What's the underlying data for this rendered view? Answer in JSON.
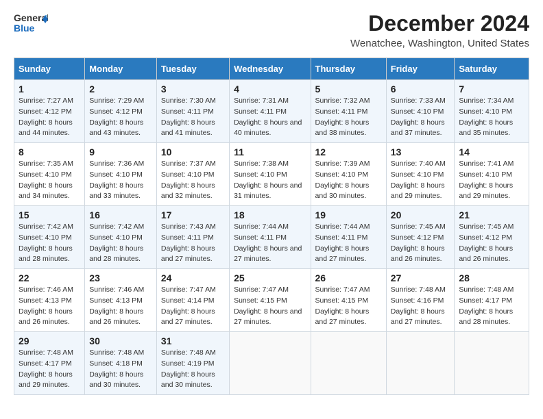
{
  "logo": {
    "line1": "General",
    "line2": "Blue"
  },
  "title": "December 2024",
  "location": "Wenatchee, Washington, United States",
  "days_header": [
    "Sunday",
    "Monday",
    "Tuesday",
    "Wednesday",
    "Thursday",
    "Friday",
    "Saturday"
  ],
  "weeks": [
    [
      {
        "day": "1",
        "sunrise": "7:27 AM",
        "sunset": "4:12 PM",
        "daylight": "8 hours and 44 minutes."
      },
      {
        "day": "2",
        "sunrise": "7:29 AM",
        "sunset": "4:12 PM",
        "daylight": "8 hours and 43 minutes."
      },
      {
        "day": "3",
        "sunrise": "7:30 AM",
        "sunset": "4:11 PM",
        "daylight": "8 hours and 41 minutes."
      },
      {
        "day": "4",
        "sunrise": "7:31 AM",
        "sunset": "4:11 PM",
        "daylight": "8 hours and 40 minutes."
      },
      {
        "day": "5",
        "sunrise": "7:32 AM",
        "sunset": "4:11 PM",
        "daylight": "8 hours and 38 minutes."
      },
      {
        "day": "6",
        "sunrise": "7:33 AM",
        "sunset": "4:10 PM",
        "daylight": "8 hours and 37 minutes."
      },
      {
        "day": "7",
        "sunrise": "7:34 AM",
        "sunset": "4:10 PM",
        "daylight": "8 hours and 35 minutes."
      }
    ],
    [
      {
        "day": "8",
        "sunrise": "7:35 AM",
        "sunset": "4:10 PM",
        "daylight": "8 hours and 34 minutes."
      },
      {
        "day": "9",
        "sunrise": "7:36 AM",
        "sunset": "4:10 PM",
        "daylight": "8 hours and 33 minutes."
      },
      {
        "day": "10",
        "sunrise": "7:37 AM",
        "sunset": "4:10 PM",
        "daylight": "8 hours and 32 minutes."
      },
      {
        "day": "11",
        "sunrise": "7:38 AM",
        "sunset": "4:10 PM",
        "daylight": "8 hours and 31 minutes."
      },
      {
        "day": "12",
        "sunrise": "7:39 AM",
        "sunset": "4:10 PM",
        "daylight": "8 hours and 30 minutes."
      },
      {
        "day": "13",
        "sunrise": "7:40 AM",
        "sunset": "4:10 PM",
        "daylight": "8 hours and 29 minutes."
      },
      {
        "day": "14",
        "sunrise": "7:41 AM",
        "sunset": "4:10 PM",
        "daylight": "8 hours and 29 minutes."
      }
    ],
    [
      {
        "day": "15",
        "sunrise": "7:42 AM",
        "sunset": "4:10 PM",
        "daylight": "8 hours and 28 minutes."
      },
      {
        "day": "16",
        "sunrise": "7:42 AM",
        "sunset": "4:10 PM",
        "daylight": "8 hours and 28 minutes."
      },
      {
        "day": "17",
        "sunrise": "7:43 AM",
        "sunset": "4:11 PM",
        "daylight": "8 hours and 27 minutes."
      },
      {
        "day": "18",
        "sunrise": "7:44 AM",
        "sunset": "4:11 PM",
        "daylight": "8 hours and 27 minutes."
      },
      {
        "day": "19",
        "sunrise": "7:44 AM",
        "sunset": "4:11 PM",
        "daylight": "8 hours and 27 minutes."
      },
      {
        "day": "20",
        "sunrise": "7:45 AM",
        "sunset": "4:12 PM",
        "daylight": "8 hours and 26 minutes."
      },
      {
        "day": "21",
        "sunrise": "7:45 AM",
        "sunset": "4:12 PM",
        "daylight": "8 hours and 26 minutes."
      }
    ],
    [
      {
        "day": "22",
        "sunrise": "7:46 AM",
        "sunset": "4:13 PM",
        "daylight": "8 hours and 26 minutes."
      },
      {
        "day": "23",
        "sunrise": "7:46 AM",
        "sunset": "4:13 PM",
        "daylight": "8 hours and 26 minutes."
      },
      {
        "day": "24",
        "sunrise": "7:47 AM",
        "sunset": "4:14 PM",
        "daylight": "8 hours and 27 minutes."
      },
      {
        "day": "25",
        "sunrise": "7:47 AM",
        "sunset": "4:15 PM",
        "daylight": "8 hours and 27 minutes."
      },
      {
        "day": "26",
        "sunrise": "7:47 AM",
        "sunset": "4:15 PM",
        "daylight": "8 hours and 27 minutes."
      },
      {
        "day": "27",
        "sunrise": "7:48 AM",
        "sunset": "4:16 PM",
        "daylight": "8 hours and 27 minutes."
      },
      {
        "day": "28",
        "sunrise": "7:48 AM",
        "sunset": "4:17 PM",
        "daylight": "8 hours and 28 minutes."
      }
    ],
    [
      {
        "day": "29",
        "sunrise": "7:48 AM",
        "sunset": "4:17 PM",
        "daylight": "8 hours and 29 minutes."
      },
      {
        "day": "30",
        "sunrise": "7:48 AM",
        "sunset": "4:18 PM",
        "daylight": "8 hours and 30 minutes."
      },
      {
        "day": "31",
        "sunrise": "7:48 AM",
        "sunset": "4:19 PM",
        "daylight": "8 hours and 30 minutes."
      },
      null,
      null,
      null,
      null
    ]
  ],
  "labels": {
    "sunrise": "Sunrise:",
    "sunset": "Sunset:",
    "daylight": "Daylight:"
  }
}
